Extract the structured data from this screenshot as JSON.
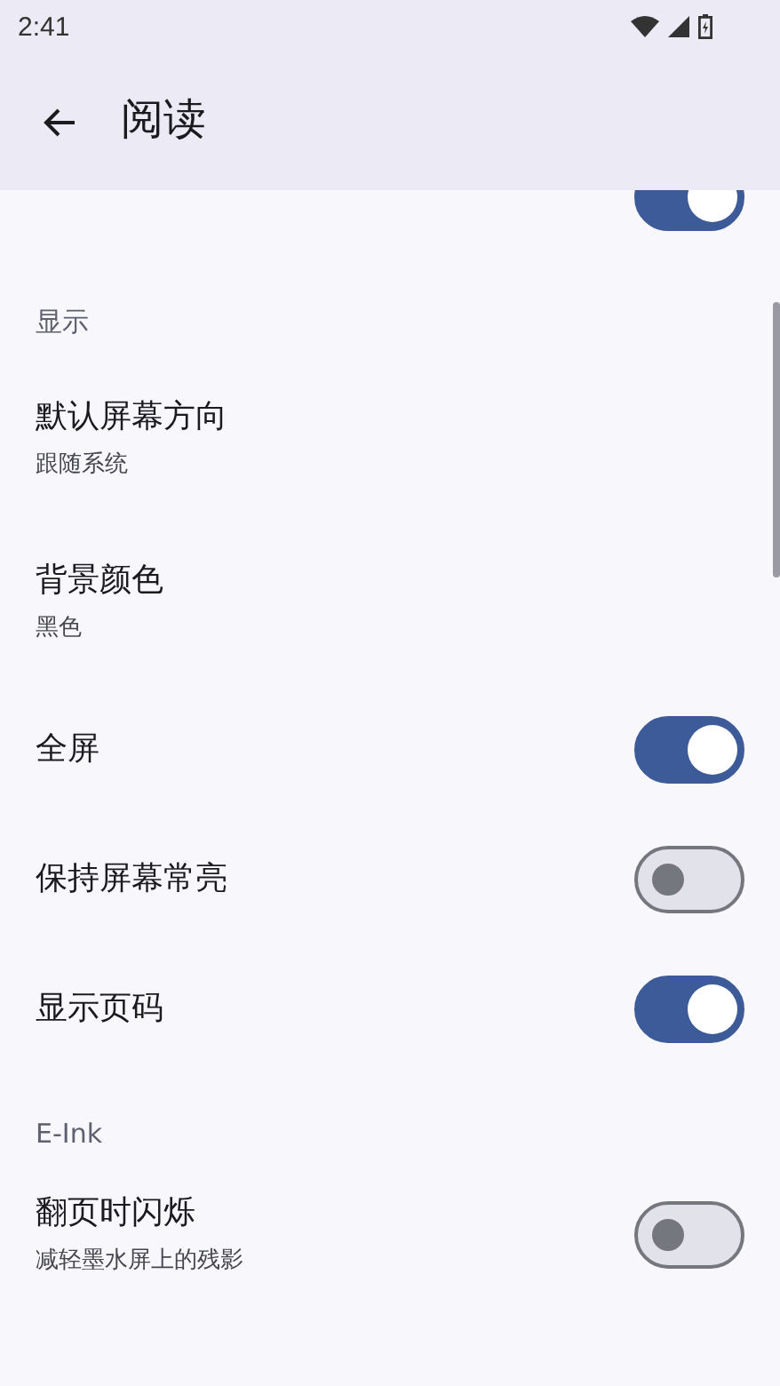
{
  "status_bar": {
    "time": "2:41"
  },
  "app_bar": {
    "title": "阅读"
  },
  "items": [
    {
      "kind": "switch",
      "on": true
    },
    {
      "kind": "section",
      "title": "显示"
    },
    {
      "kind": "preference",
      "title": "默认屏幕方向",
      "summary": "跟随系统"
    },
    {
      "kind": "preference",
      "title": "背景颜色",
      "summary": "黑色"
    },
    {
      "kind": "switch",
      "title": "全屏",
      "on": true
    },
    {
      "kind": "switch",
      "title": "保持屏幕常亮",
      "on": false
    },
    {
      "kind": "switch",
      "title": "显示页码",
      "on": true
    },
    {
      "kind": "section",
      "title": "E-Ink"
    },
    {
      "kind": "switch",
      "title": "翻页时闪烁",
      "summary": "减轻墨水屏上的残影",
      "on": false
    }
  ]
}
